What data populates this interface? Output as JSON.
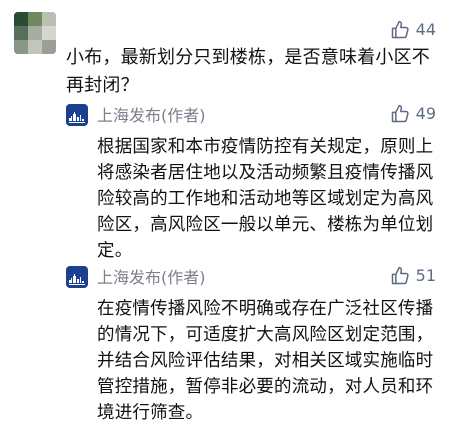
{
  "comment": {
    "likes": "44",
    "text": "小布，最新划分只到楼栋，是否意味着小区不再封闭？"
  },
  "replies": [
    {
      "author": "上海发布(作者)",
      "likes": "49",
      "text": "根据国家和本市疫情防控有关规定，原则上将感染者居住地以及活动频繁且疫情传播风险较高的工作地和活动地等区域划定为高风险区，高风险区一般以单元、楼栋为单位划定。"
    },
    {
      "author": "上海发布(作者)",
      "likes": "51",
      "text": "在疫情传播风险不明确或存在广泛社区传播的情况下，可适度扩大高风险区划定范围，并结合风险评估结果，对相关区域实施临时管控措施，暂停非必要的流动，对人员和环境进行筛查。"
    }
  ],
  "colors": {
    "like": "#5d6b86",
    "author": "#7a7f8a",
    "avatar_brand": "#1d3f8f"
  },
  "icons": {
    "like": "thumbs-up-icon",
    "avatar": "shanghai-skyline-logo"
  }
}
